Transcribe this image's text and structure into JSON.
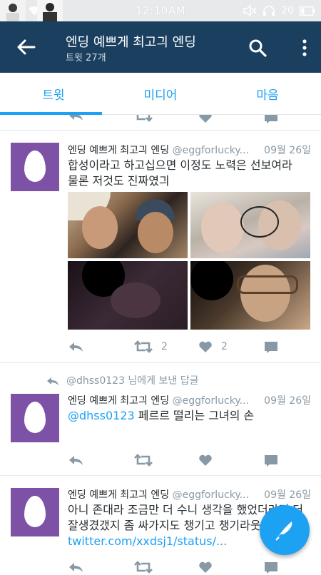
{
  "status_bar": {
    "time": "12:10AM",
    "battery": "20"
  },
  "header": {
    "title": "엔딩 예쁘게 최고긔 엔딩",
    "subtitle": "트윗 27개"
  },
  "tabs": [
    {
      "label": "트윗"
    },
    {
      "label": "미디어"
    },
    {
      "label": "마음"
    }
  ],
  "tweets": [
    {
      "name": "엔딩 예쁘게 최고긔 엔딩",
      "handle": "@eggforlucky...",
      "date": "09월 26일",
      "text_line1": "합성이라고 하고십으면 이정도 노력은 선보여라",
      "text_line2": "물론 저것도 진짜였긔",
      "retweets": "2",
      "likes": "2"
    },
    {
      "reply_context": "@dhss0123 님에게 보낸 답글",
      "name": "엔딩 예쁘게 최고긔 엔딩",
      "handle": "@eggforlucky...",
      "date": "09월 26일",
      "mention": "@dhss0123",
      "text": " 페르르 떨리는 그녀의 손"
    },
    {
      "name": "엔딩 예쁘게 최고긔 엔딩",
      "handle": "@eggforlucky...",
      "date": "09월 26일",
      "text_line1": "아니 존대라 조금만 더 수니 생각을 했었더라면 더",
      "text_line2": "잘생겼갰지 좀 싸가지도 챙기고 챙기라웃",
      "link": "twitter.com/xxdsj1/status/..."
    }
  ],
  "colors": {
    "header_bg": "#1b3f5f",
    "accent": "#1da1f2",
    "avatar_bg": "#7c51a6",
    "muted": "#8899a6"
  },
  "icons": {
    "back": "arrow-left-icon",
    "search": "search-icon",
    "more": "more-vert-icon",
    "reply": "reply-icon",
    "retweet": "retweet-icon",
    "like": "heart-icon",
    "dm": "envelope-icon",
    "compose": "compose-icon"
  }
}
